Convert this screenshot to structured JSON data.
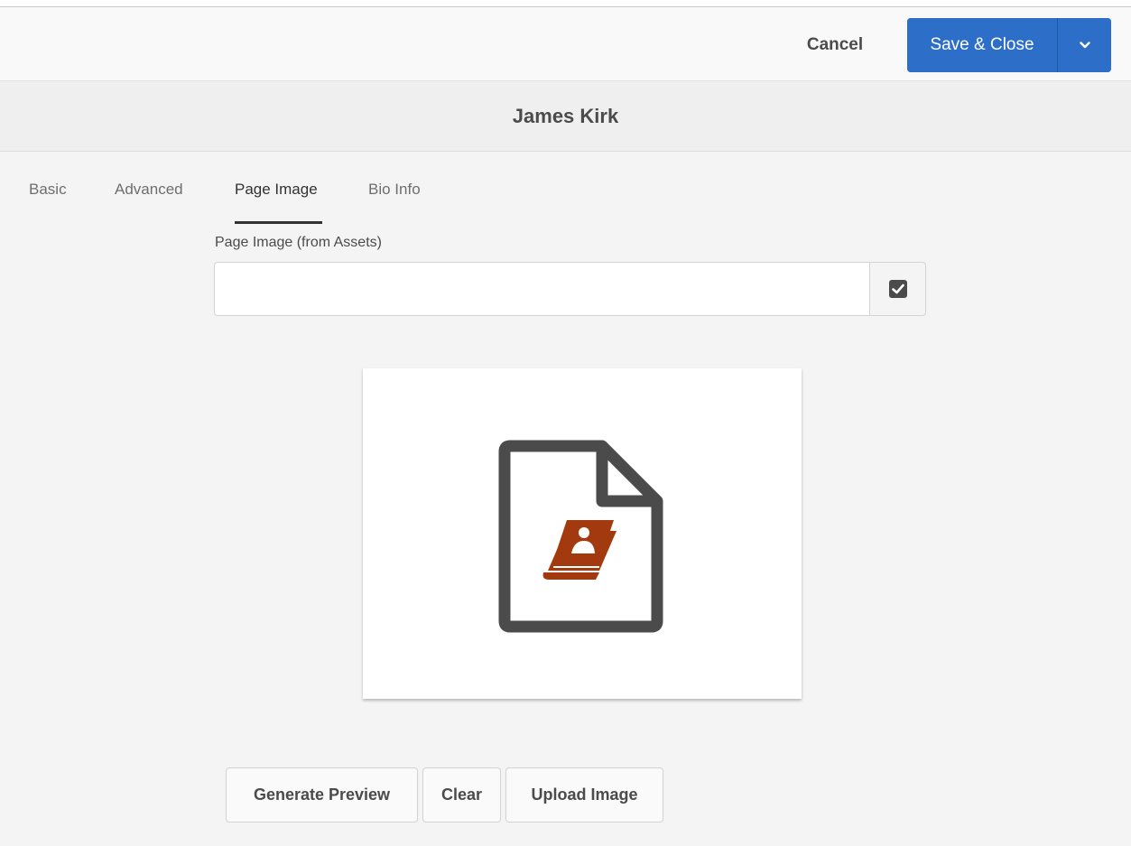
{
  "toolbar": {
    "cancel_label": "Cancel",
    "save_label": "Save & Close",
    "accent_color": "#2d6ec9"
  },
  "dialog": {
    "title": "James Kirk"
  },
  "tabs": [
    {
      "label": "Basic",
      "active": false
    },
    {
      "label": "Advanced",
      "active": false
    },
    {
      "label": "Page Image",
      "active": true
    },
    {
      "label": "Bio Info",
      "active": false
    }
  ],
  "page_image": {
    "field_label": "Page Image (from Assets)",
    "field_value": "",
    "picker_icon": "checkbox-picker-icon",
    "preview_icon": "document-contact-book-icon",
    "icon_accent_color": "#a33a0f"
  },
  "actions": {
    "generate_preview_label": "Generate Preview",
    "clear_label": "Clear",
    "upload_image_label": "Upload Image"
  }
}
